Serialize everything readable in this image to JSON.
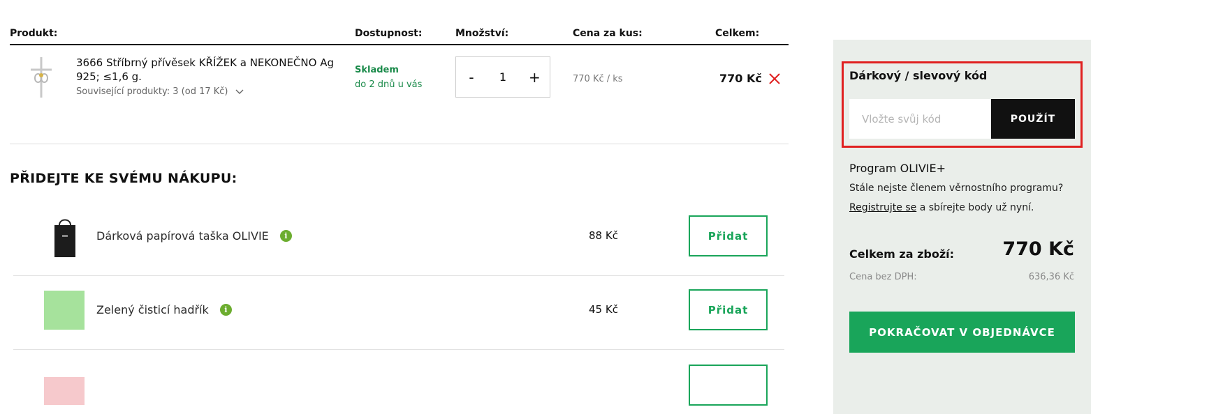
{
  "table": {
    "headers": {
      "product": "Produkt:",
      "availability": "Dostupnost:",
      "quantity": "Množství:",
      "unit_price": "Cena za kus:",
      "total": "Celkem:"
    },
    "item": {
      "name": "3666 Stříbrný přívěsek KŘÍŽEK a NEKONEČNO Ag 925; ≤1,6 g.",
      "related": "Související produkty: 3 (od 17 Kč)",
      "stock": "Skladem",
      "stock_sub": "do 2 dnů u vás",
      "qty_minus": "-",
      "qty_value": "1",
      "qty_plus": "+",
      "unit_price": "770 Kč / ks",
      "total": "770 Kč",
      "remove_icon": "close-icon",
      "remove_color": "#e02020"
    }
  },
  "addons": {
    "title": "PŘIDEJTE KE SVÉMU NÁKUPU:",
    "items": [
      {
        "name": "Dárková papírová taška OLIVIE",
        "price": "88 Kč",
        "button": "Přidat",
        "thumb": "gift-bag-image"
      },
      {
        "name": "Zelený čisticí hadřík",
        "price": "45 Kč",
        "button": "Přidat",
        "thumb": "green-cloth-image"
      },
      {
        "name": "",
        "price": "",
        "button": "",
        "thumb": "pink-cloth-image"
      }
    ],
    "info_icon": "i"
  },
  "sidebar": {
    "coupon_label": "Dárkový / slevový kód",
    "coupon_placeholder": "Vložte svůj kód",
    "coupon_button": "POUŽÍT",
    "program_title": "Program OLIVIE+",
    "program_text": "Stále nejste členem věrnostního programu?",
    "register_link": "Registrujte se",
    "register_rest": " a sbírejte body už nyní.",
    "sum_label": "Celkem za zboží:",
    "sum_value": "770 Kč",
    "vat_label": "Cena bez DPH:",
    "vat_value": "636,36 Kč",
    "continue_button": "POKRAČOVAT V OBJEDNÁVCE"
  },
  "colors": {
    "accent_green": "#19a55a",
    "stock_green": "#1a8a4a",
    "highlight_red": "#e02020",
    "sidebar_bg": "#eaeeea"
  }
}
